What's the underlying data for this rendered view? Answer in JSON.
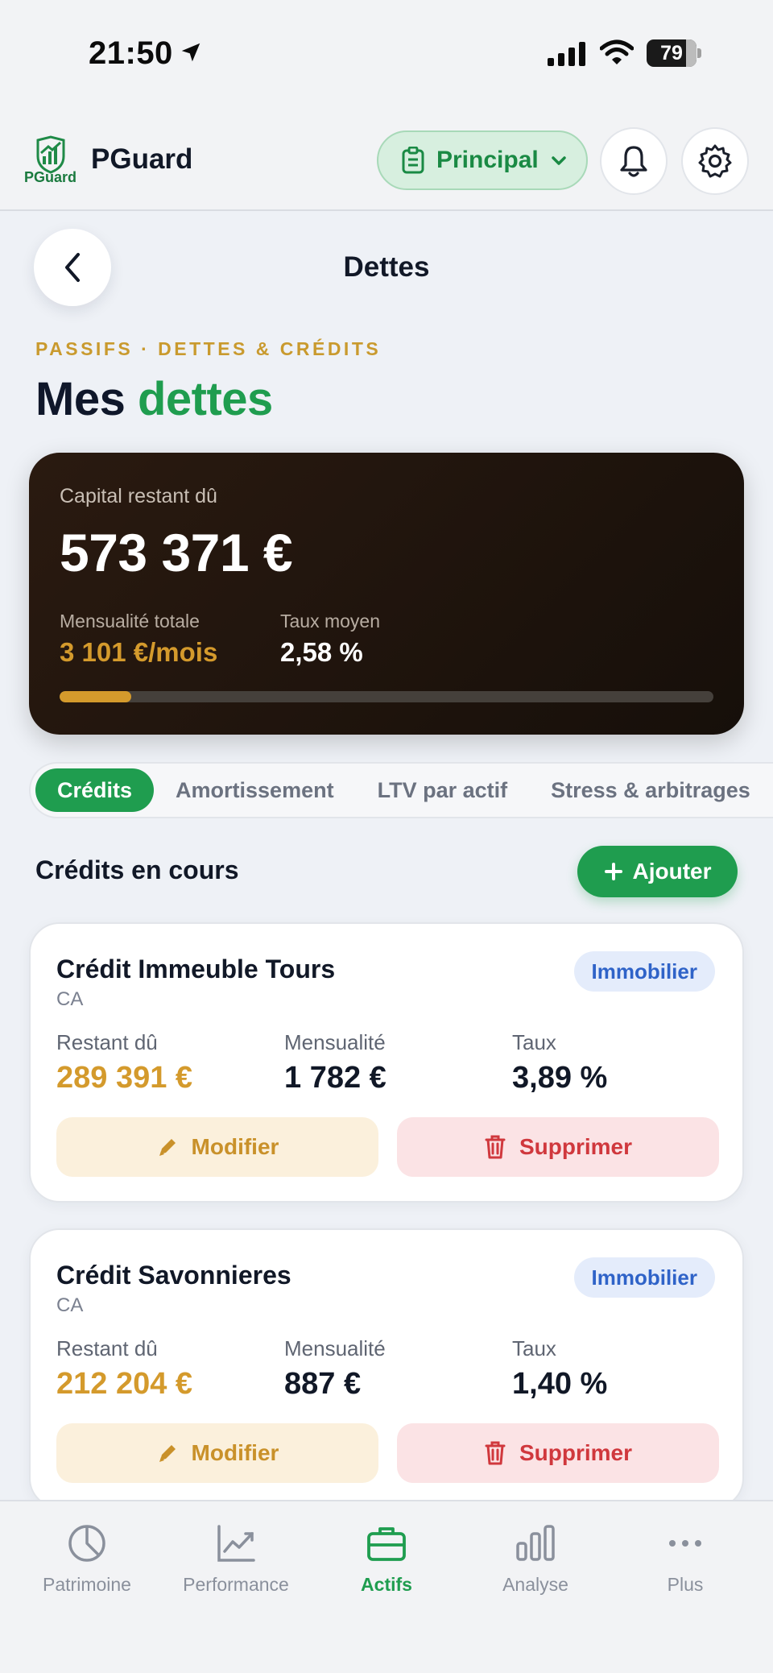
{
  "status_bar": {
    "time": "21:50",
    "battery": "79",
    "battery_level": 0.79
  },
  "header": {
    "brand": "PGuard",
    "logo_text": "PGuard",
    "portfolio_selector": "Principal",
    "icons": [
      "bell-icon",
      "gear-icon"
    ]
  },
  "page": {
    "title": "Dettes",
    "eyebrow": "PASSIFS · DETTES & CRÉDITS",
    "headline_part1": "Mes",
    "headline_part2": "dettes"
  },
  "summary": {
    "capital_label": "Capital restant dû",
    "capital_value": "573 371 €",
    "monthly_label": "Mensualité totale",
    "monthly_value": "3 101 €/mois",
    "rate_label": "Taux moyen",
    "rate_value": "2,58 %",
    "progress": 0.11,
    "colors": {
      "background": "#1f140d",
      "accent": "#d49a2c"
    }
  },
  "tabs": [
    {
      "label": "Crédits",
      "active": true
    },
    {
      "label": "Amortissement",
      "active": false
    },
    {
      "label": "LTV par actif",
      "active": false
    },
    {
      "label": "Stress & arbitrages",
      "active": false
    }
  ],
  "section": {
    "title": "Crédits en cours",
    "add_label": "Ajouter"
  },
  "loans": [
    {
      "name": "Crédit Immeuble Tours",
      "bank": "CA",
      "badge": "Immobilier",
      "remaining_label": "Restant dû",
      "remaining": "289 391 €",
      "payment_label": "Mensualité",
      "payment": "1 782 €",
      "rate_label": "Taux",
      "rate": "3,89 %",
      "edit_label": "Modifier",
      "delete_label": "Supprimer"
    },
    {
      "name": "Crédit Savonnieres",
      "bank": "CA",
      "badge": "Immobilier",
      "remaining_label": "Restant dû",
      "remaining": "212 204 €",
      "payment_label": "Mensualité",
      "payment": "887 €",
      "rate_label": "Taux",
      "rate": "1,40 %",
      "edit_label": "Modifier",
      "delete_label": "Supprimer"
    }
  ],
  "bottom_nav": [
    {
      "label": "Patrimoine",
      "icon": "pie-chart-icon",
      "active": false
    },
    {
      "label": "Performance",
      "icon": "trend-chart-icon",
      "active": false
    },
    {
      "label": "Actifs",
      "icon": "briefcase-icon",
      "active": true
    },
    {
      "label": "Analyse",
      "icon": "bar-chart-icon",
      "active": false
    },
    {
      "label": "Plus",
      "icon": "more-dots-icon",
      "active": false
    }
  ],
  "colors": {
    "brand_green": "#1f9d4f",
    "gold": "#d49a2c",
    "danger": "#d0383d",
    "info": "#2f63c8"
  }
}
